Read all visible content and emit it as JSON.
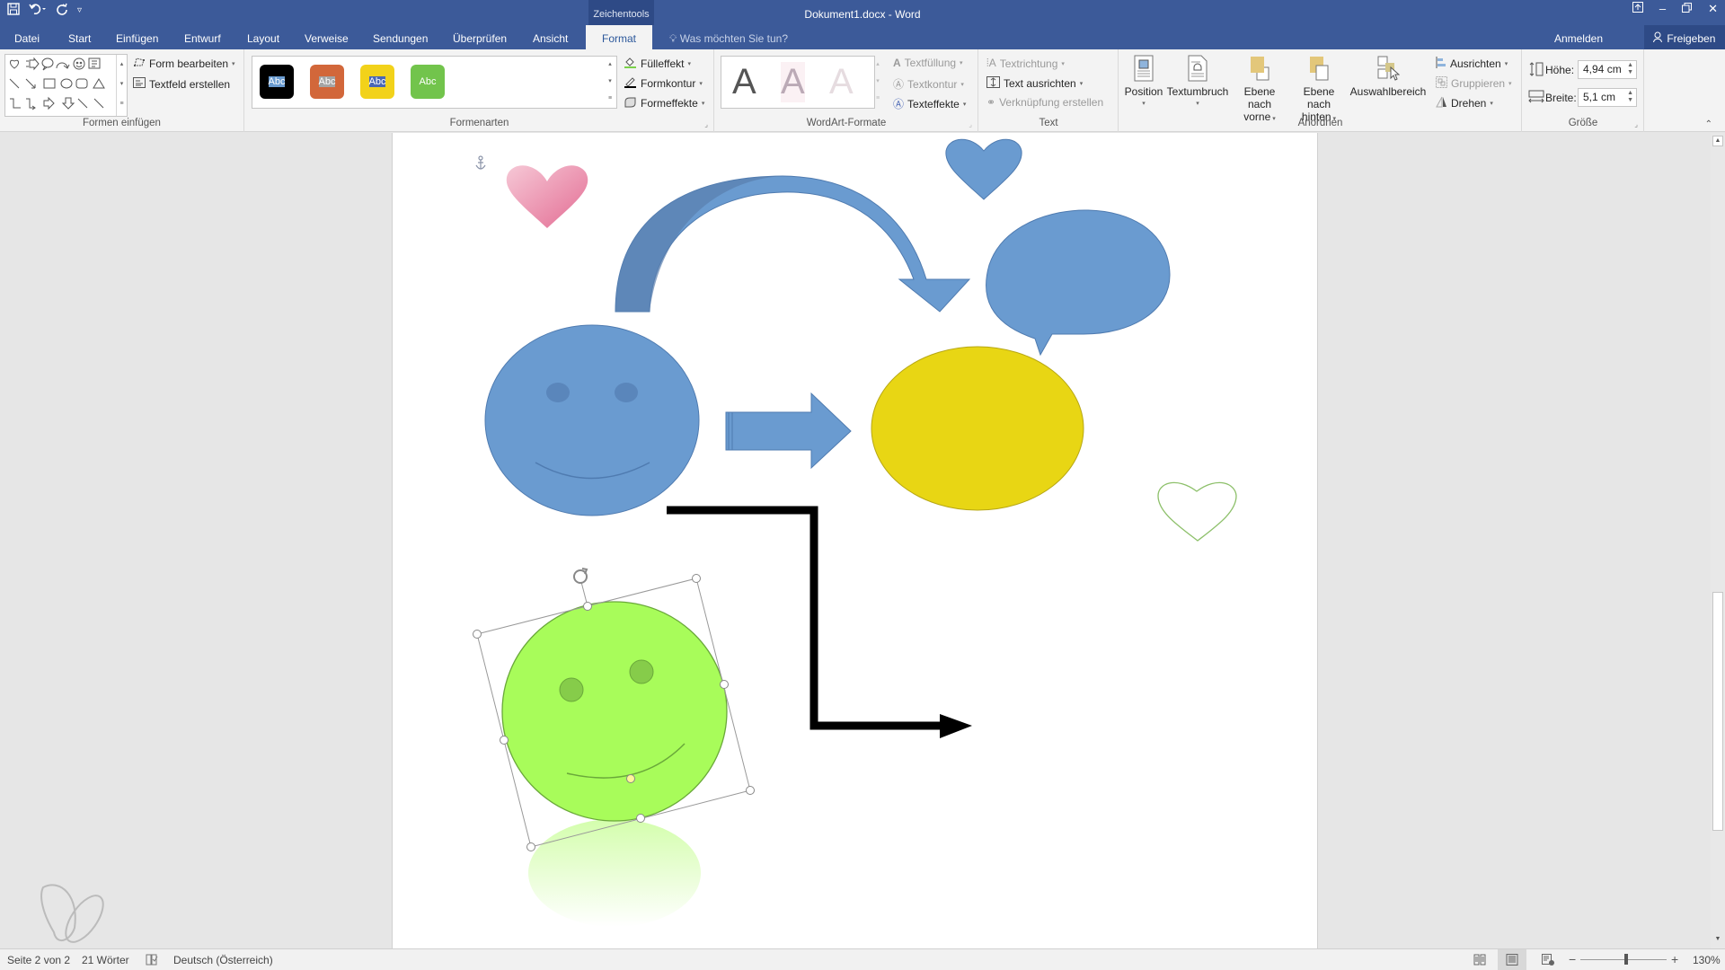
{
  "titlebar": {
    "context_tab_group": "Zeichentools",
    "document_title": "Dokument1.docx - Word",
    "qat_icons": [
      "save-icon",
      "undo-icon",
      "redo-icon",
      "customize-qat-icon"
    ],
    "window_controls": [
      "ribbon-display-icon",
      "minimize-icon",
      "restore-icon",
      "close-icon"
    ]
  },
  "tabs": [
    {
      "label": "Datei"
    },
    {
      "label": "Start"
    },
    {
      "label": "Einfügen"
    },
    {
      "label": "Entwurf"
    },
    {
      "label": "Layout"
    },
    {
      "label": "Verweise"
    },
    {
      "label": "Sendungen"
    },
    {
      "label": "Überprüfen"
    },
    {
      "label": "Ansicht"
    },
    {
      "label": "Format",
      "active": true
    }
  ],
  "tell_me": "Was möchten Sie tun?",
  "account": {
    "sign_in": "Anmelden",
    "share": "Freigeben"
  },
  "ribbon": {
    "formen_einfuegen": {
      "label": "Formen einfügen",
      "form_bearbeiten": "Form bearbeiten",
      "textfeld_erstellen": "Textfeld erstellen"
    },
    "formenarten": {
      "label": "Formenarten",
      "styles": [
        {
          "text": "Abc",
          "color": "#000000"
        },
        {
          "text": "Abc",
          "color": "#6a9bd0"
        },
        {
          "text": "Abc",
          "color": "#d2673a"
        },
        {
          "text": "Abc",
          "color": "#a5a5a5"
        },
        {
          "text": "Abc",
          "color": "#f2d21a"
        },
        {
          "text": "Abc",
          "color": "#4a67b5"
        },
        {
          "text": "Abc",
          "color": "#72c44c"
        }
      ],
      "fuelleffekt": "Fülleffekt",
      "formkontur": "Formkontur",
      "formeffekte": "Formeffekte"
    },
    "wordart": {
      "label": "WordArt-Formate",
      "sample": "A",
      "textfuellung": "Textfüllung",
      "textkontur": "Textkontur",
      "texteffekte": "Texteffekte"
    },
    "text": {
      "label": "Text",
      "textrichtung": "Textrichtung",
      "text_ausrichten": "Text ausrichten",
      "verknuepfung": "Verknüpfung erstellen"
    },
    "anordnen": {
      "label": "Anordnen",
      "position": "Position",
      "textumbruch": "Textumbruch",
      "ebene_vorne_1": "Ebene nach",
      "ebene_vorne_2": "vorne",
      "ebene_hinten_1": "Ebene nach",
      "ebene_hinten_2": "hinten",
      "auswahlbereich": "Auswahlbereich",
      "ausrichten": "Ausrichten",
      "gruppieren": "Gruppieren",
      "drehen": "Drehen"
    },
    "groesse": {
      "label": "Größe",
      "hoehe_label": "Höhe:",
      "hoehe_value": "4,94  cm",
      "breite_label": "Breite:",
      "breite_value": "5,1  cm"
    }
  },
  "document": {
    "shapes": [
      {
        "type": "heart",
        "fill": "gradient pink"
      },
      {
        "type": "curved-arrow",
        "fill": "#6a9bd0"
      },
      {
        "type": "heart",
        "fill": "#6a9bd0"
      },
      {
        "type": "speech-bubble",
        "fill": "#6a9bd0"
      },
      {
        "type": "smiley",
        "fill": "#6a9bd0"
      },
      {
        "type": "right-arrow",
        "fill": "#6a9bd0"
      },
      {
        "type": "ellipse",
        "fill": "#e8d614"
      },
      {
        "type": "heart-outline",
        "stroke": "#8dc06a"
      },
      {
        "type": "elbow-connector-arrow",
        "stroke": "#000000"
      },
      {
        "type": "smiley",
        "fill": "#a8fc5a",
        "selected": true
      }
    ]
  },
  "statusbar": {
    "page": "Seite 2 von 2",
    "words": "21 Wörter",
    "language": "Deutsch (Österreich)",
    "zoom": "130%",
    "zoom_percent": 130
  }
}
